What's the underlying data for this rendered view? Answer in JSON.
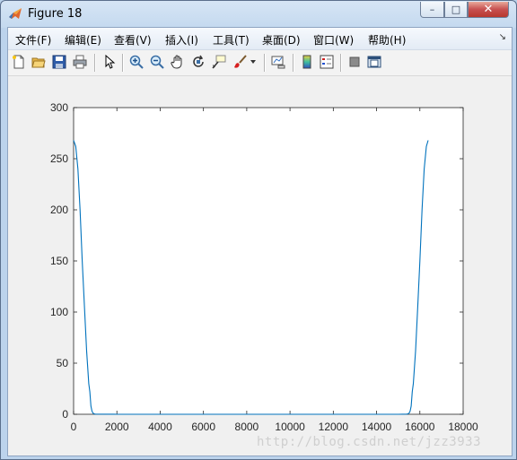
{
  "window": {
    "title": "Figure 18",
    "minimize": "–",
    "maximize": "□",
    "close": "✕"
  },
  "menu": {
    "items": [
      "文件(F)",
      "编辑(E)",
      "查看(V)",
      "插入(I)",
      "工具(T)",
      "桌面(D)",
      "窗口(W)",
      "帮助(H)"
    ],
    "overflow_arrow": "↘"
  },
  "toolbar": {
    "buttons": [
      "new-figure-icon",
      "open-file-icon",
      "save-icon",
      "print-icon",
      "select-arrow-icon",
      "zoom-in-icon",
      "zoom-out-icon",
      "pan-hand-icon",
      "rotate-3d-icon",
      "data-cursor-icon",
      "brush-icon",
      "link-plot-icon",
      "colorbar-icon",
      "legend-icon",
      "hide-plot-tools-icon",
      "show-plot-tools-icon"
    ]
  },
  "chart_data": {
    "type": "line",
    "title": "",
    "xlabel": "",
    "ylabel": "",
    "xlim": [
      0,
      18000
    ],
    "ylim": [
      0,
      300
    ],
    "xticks": [
      "0",
      "2000",
      "4000",
      "6000",
      "8000",
      "10000",
      "12000",
      "14000",
      "16000",
      "18000"
    ],
    "yticks": [
      "0",
      "50",
      "100",
      "150",
      "200",
      "250",
      "300"
    ],
    "grid": false,
    "line_color": "#0072bd",
    "series": [
      {
        "x": [
          0,
          100,
          200,
          300,
          400,
          500,
          600,
          700,
          750,
          800,
          850,
          900,
          950,
          1000,
          2000,
          4000,
          6000,
          8000,
          10000,
          12000,
          14000,
          15000,
          15400,
          15450,
          15500,
          15550,
          15600,
          15650,
          15700,
          15800,
          15900,
          16000,
          16100,
          16200,
          16300,
          16384
        ],
        "y": [
          268,
          262,
          240,
          200,
          150,
          105,
          62,
          30,
          22,
          8,
          3,
          1,
          0.4,
          0.2,
          0,
          0,
          0,
          0,
          0,
          0,
          0,
          0,
          0.2,
          0.4,
          1,
          3,
          8,
          22,
          30,
          62,
          105,
          150,
          200,
          240,
          262,
          268
        ]
      }
    ]
  },
  "watermark": "http://blog.csdn.net/jzz3933"
}
